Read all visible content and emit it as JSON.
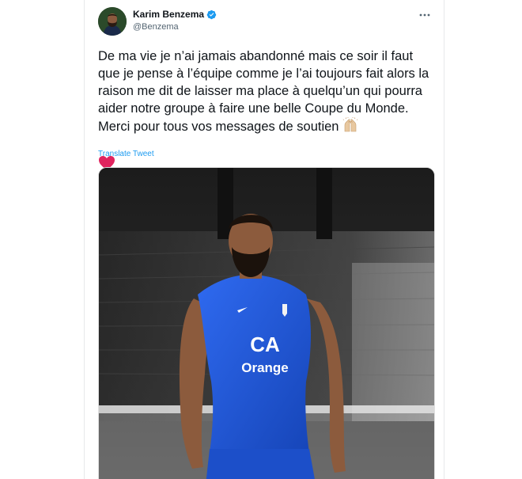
{
  "tweet": {
    "display_name": "Karim Benzema",
    "handle": "@Benzema",
    "text": "De ma vie je n’ai jamais abandonné mais ce soir il faut que je pense à l’équipe comme je l’ai toujours fait alors la raison me dit de laisser ma place à quelqu’un qui pourra aider notre groupe à faire une belle Coupe du Monde. Merci pour tous vos messages de soutien",
    "translate_label": "Translate Tweet",
    "verified": true,
    "emojis": [
      "raising-hands",
      "red-heart"
    ],
    "media": {
      "jersey_sponsor": "Orange",
      "jersey_badge": "CA"
    }
  },
  "colors": {
    "link": "#1d9bf0",
    "verified": "#1d9bf0",
    "jersey": "#1f56d6",
    "heart": "#e0245e"
  },
  "icons": {
    "verified": "verified-badge-icon",
    "more": "more-options-icon"
  }
}
